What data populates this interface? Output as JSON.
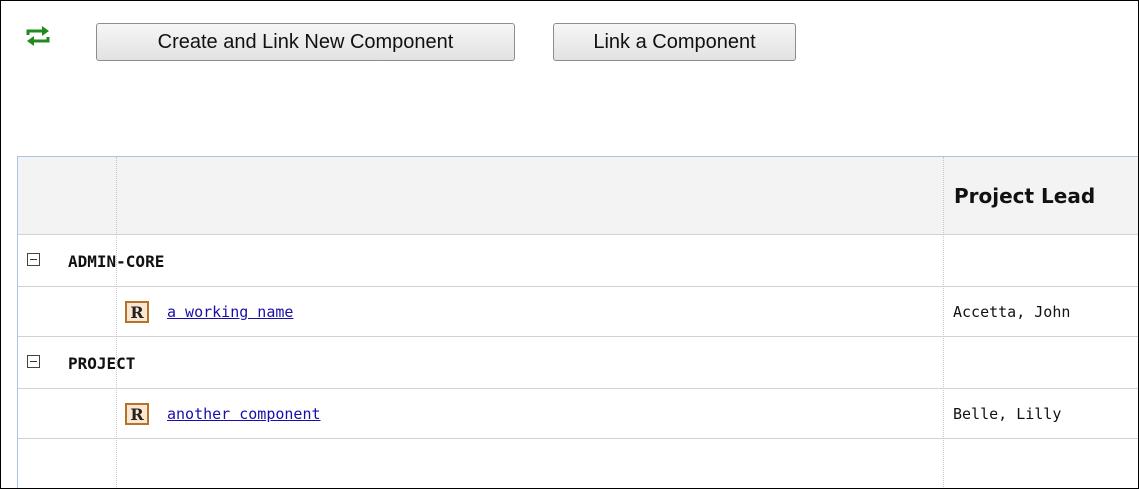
{
  "toolbar": {
    "sync_icon": "sync-arrows-icon",
    "sync_icon_color": "#1f8a1f",
    "create_button_label": "Create and Link New Component",
    "link_button_label": "Link a Component"
  },
  "table": {
    "columns": [
      "",
      "",
      "Project Lead"
    ],
    "groups": [
      {
        "name": "ADMIN-CORE",
        "expanded": true,
        "items": [
          {
            "badge": "R",
            "name": "a working name",
            "lead": "Accetta, John"
          }
        ]
      },
      {
        "name": "PROJECT",
        "expanded": true,
        "items": [
          {
            "badge": "R",
            "name": "another component",
            "lead": "Belle, Lilly"
          }
        ]
      }
    ]
  },
  "colors": {
    "link": "#1a0dab",
    "badge_border": "#b4722c",
    "badge_fill": "#fbe7cf",
    "header_bg": "#f3f3f3",
    "grid_border": "#a8c4e3"
  }
}
